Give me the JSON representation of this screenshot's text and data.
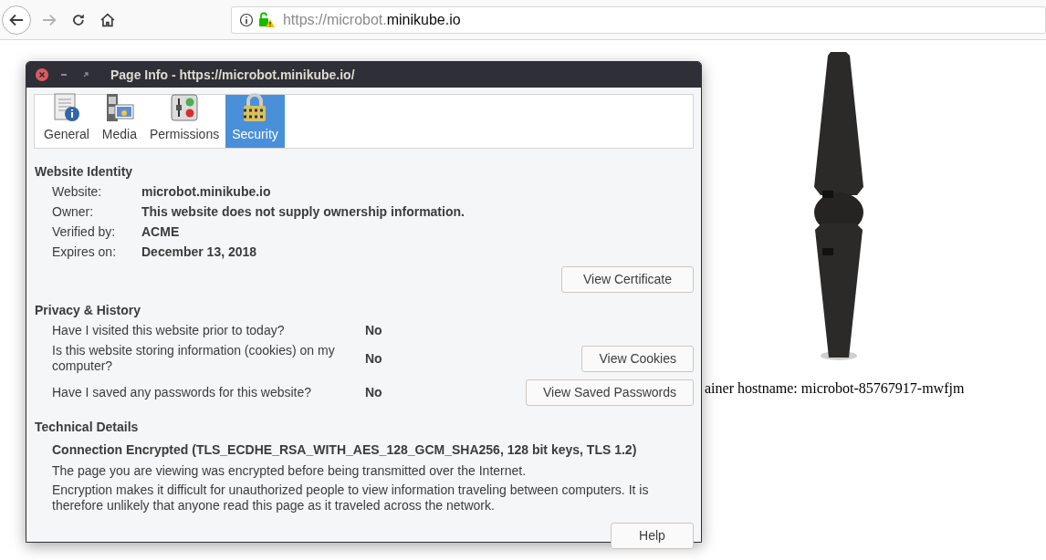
{
  "toolbar": {
    "url_prefix": "https://microbot.",
    "url_domain": "minikube.io",
    "forward_disabled": true
  },
  "page": {
    "hostname_text": "ainer hostname: microbot-85767917-mwfjm"
  },
  "dialog": {
    "title": "Page Info - https://microbot.minikube.io/",
    "tabs": [
      {
        "label": "General",
        "selected": false,
        "kind": "general"
      },
      {
        "label": "Media",
        "selected": false,
        "kind": "media"
      },
      {
        "label": "Permissions",
        "selected": false,
        "kind": "permissions"
      },
      {
        "label": "Security",
        "selected": true,
        "kind": "security"
      }
    ],
    "identity": {
      "heading": "Website Identity",
      "rows": [
        {
          "label": "Website:",
          "value": "microbot.minikube.io"
        },
        {
          "label": "Owner:",
          "value": "This website does not supply ownership information."
        },
        {
          "label": "Verified by:",
          "value": "ACME"
        },
        {
          "label": "Expires on:",
          "value": "December 13, 2018"
        }
      ],
      "button": "View Certificate"
    },
    "privacy": {
      "heading": "Privacy & History",
      "rows": [
        {
          "question": "Have I visited this website prior to today?",
          "answer": "No"
        },
        {
          "question": "Is this website storing information (cookies) on my computer?",
          "answer": "No",
          "button": "View Cookies"
        },
        {
          "question": "Have I saved any passwords for this website?",
          "answer": "No",
          "button": "View Saved Passwords"
        }
      ]
    },
    "technical": {
      "heading": "Technical Details",
      "status": "Connection Encrypted (TLS_ECDHE_RSA_WITH_AES_128_GCM_SHA256, 128 bit keys, TLS 1.2)",
      "paragraphs": [
        "The page you are viewing was encrypted before being transmitted over the Internet.",
        "Encryption makes it difficult for unauthorized people to view information traveling between computers. It is therefore unlikely that anyone read this page as it traveled across the network."
      ]
    },
    "help_button": "Help"
  }
}
